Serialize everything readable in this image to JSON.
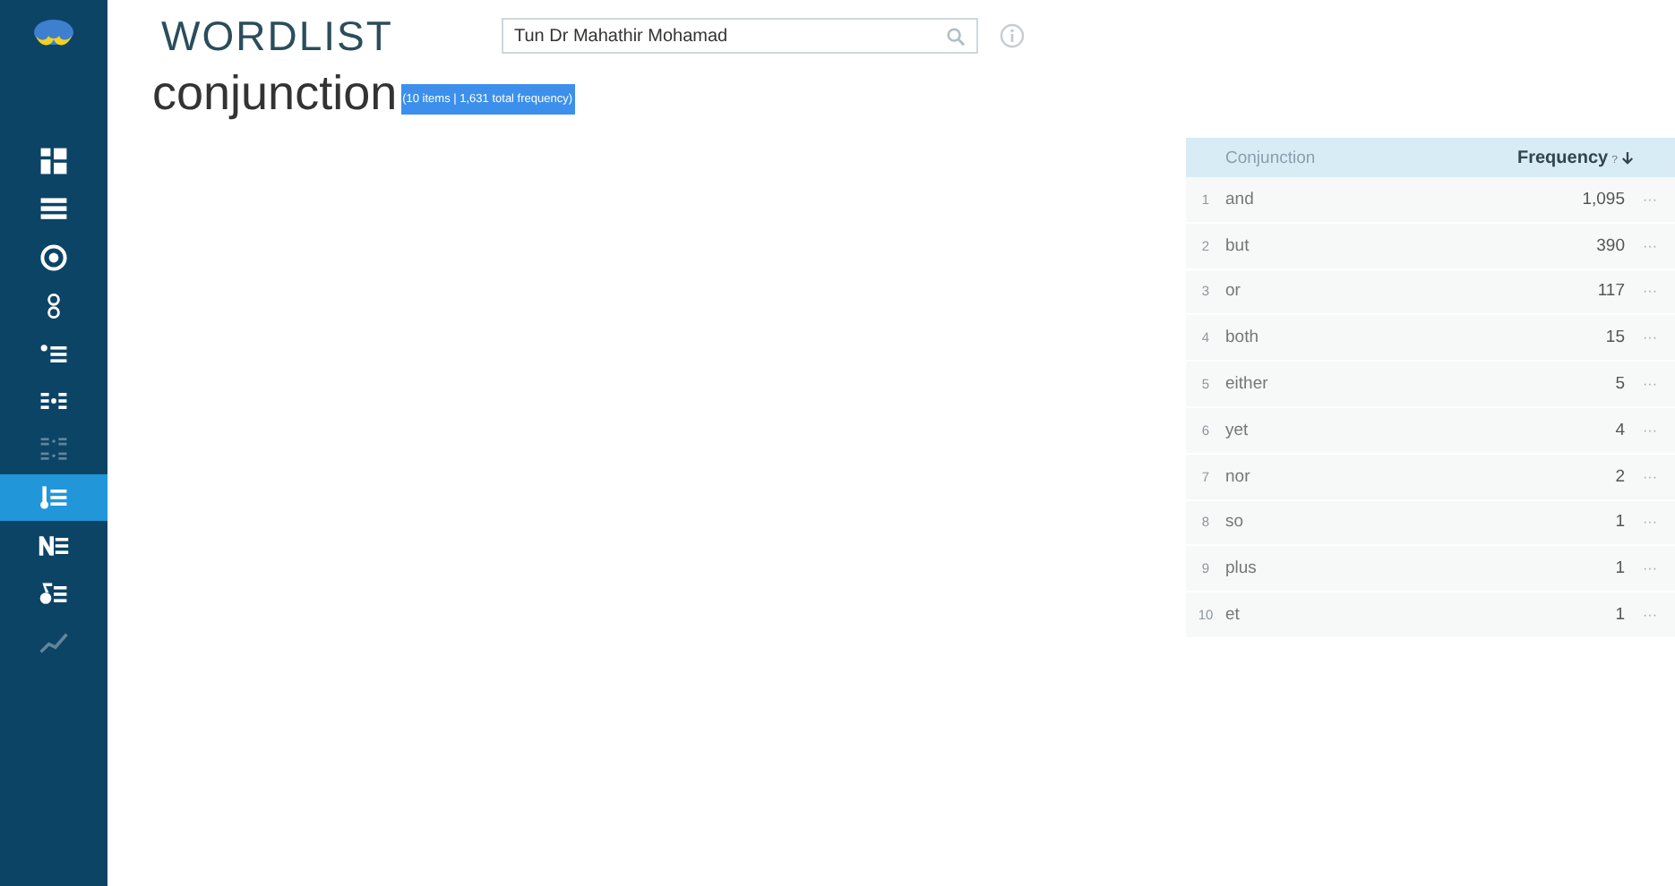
{
  "sidebar": {
    "items": [
      {
        "kind": "dashboard",
        "selected": false,
        "disabled": false
      },
      {
        "kind": "list",
        "selected": false,
        "disabled": false
      },
      {
        "kind": "target",
        "selected": false,
        "disabled": false
      },
      {
        "kind": "chain",
        "selected": false,
        "disabled": false
      },
      {
        "kind": "dot-list",
        "selected": false,
        "disabled": false
      },
      {
        "kind": "compare",
        "selected": false,
        "disabled": false
      },
      {
        "kind": "compare-grid",
        "selected": false,
        "disabled": true
      },
      {
        "kind": "sort-list",
        "selected": true,
        "disabled": false
      },
      {
        "kind": "n-list",
        "selected": false,
        "disabled": false
      },
      {
        "kind": "delta-list",
        "selected": false,
        "disabled": false
      },
      {
        "kind": "trend",
        "selected": false,
        "disabled": true
      }
    ]
  },
  "header": {
    "title": "WORDLIST",
    "search": {
      "value": "Tun Dr Mahathir Mohamad"
    }
  },
  "subtitle": {
    "word": "conjunction",
    "summary": "(10 items | 1,631 total frequency)"
  },
  "table": {
    "columns": [
      {
        "label": "Conjunction"
      },
      {
        "label": "Frequency",
        "help": "?"
      }
    ],
    "rows": [
      {
        "number": "1",
        "word": "and",
        "frequency": "1,095",
        "menu": "···"
      },
      {
        "number": "2",
        "word": "but",
        "frequency": "390",
        "menu": "···"
      },
      {
        "number": "3",
        "word": "or",
        "frequency": "117",
        "menu": "···"
      },
      {
        "number": "4",
        "word": "both",
        "frequency": "15",
        "menu": "···"
      },
      {
        "number": "5",
        "word": "either",
        "frequency": "5",
        "menu": "···"
      },
      {
        "number": "6",
        "word": "yet",
        "frequency": "4",
        "menu": "···"
      },
      {
        "number": "7",
        "word": "nor",
        "frequency": "2",
        "menu": "···"
      },
      {
        "number": "8",
        "word": "so",
        "frequency": "1",
        "menu": "···"
      },
      {
        "number": "9",
        "word": "plus",
        "frequency": "1",
        "menu": "···"
      },
      {
        "number": "10",
        "word": "et",
        "frequency": "1",
        "menu": "···"
      }
    ]
  }
}
